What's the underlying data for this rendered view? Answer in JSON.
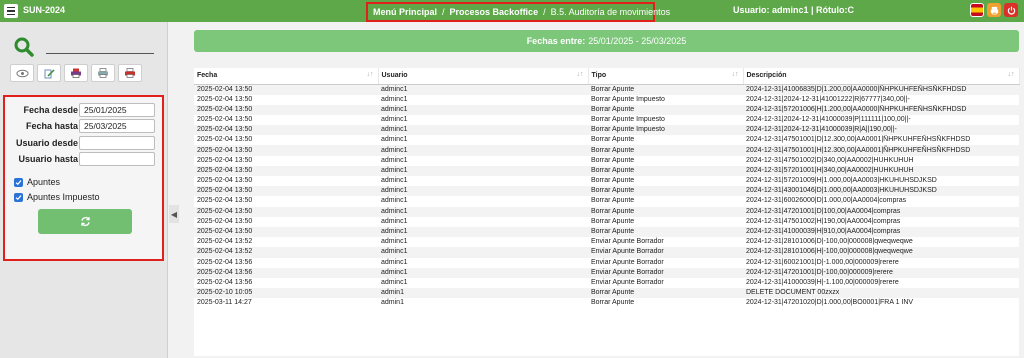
{
  "app": {
    "title": "SUN-2024",
    "user": "Usuario: adminc1 | Rótulo:C",
    "breadcrumb": [
      {
        "label": "Menú Principal"
      },
      {
        "label": "Procesos Backoffice"
      },
      {
        "label": "B.5. Auditoría de movimientos"
      }
    ],
    "separator": "/"
  },
  "icons": {
    "menu": "hamburger-menu-icon",
    "flag": "spain-flag-icon",
    "print": "print-icon",
    "power": "power-icon",
    "search": "search-icon",
    "tools": [
      "eye-icon",
      "edit-document-icon",
      "print-icon",
      "printer-alt-icon",
      "pdf-print-icon"
    ],
    "refresh": "refresh-icon",
    "collapse": "chevron-left-icon"
  },
  "colors": {
    "topbar": "#5fa84a",
    "banner": "#7cc77a",
    "highlight": "#e0201a",
    "refresh": "#72bf72"
  },
  "filters": {
    "fecha_desde_label": "Fecha desde",
    "fecha_desde_value": "25/01/2025",
    "fecha_hasta_label": "Fecha hasta",
    "fecha_hasta_value": "25/03/2025",
    "usuario_desde_label": "Usuario desde",
    "usuario_desde_value": "",
    "usuario_hasta_label": "Usuario hasta",
    "usuario_hasta_value": "",
    "apuntes_label": "Apuntes",
    "apuntes_checked": true,
    "apuntes_impuesto_label": "Apuntes Impuesto",
    "apuntes_impuesto_checked": true
  },
  "banner": {
    "label": "Fechas entre:",
    "value": "25/01/2025 - 25/03/2025"
  },
  "table": {
    "columns": [
      "Fecha",
      "Usuario",
      "Tipo",
      "Descripción"
    ],
    "rows": [
      [
        "2025-02-04 13:50",
        "adminc1",
        "Borrar Apunte",
        "2024-12-31|41006835|D|1.200,00|AA0000|ÑHPKUHFEÑHSÑKFHDSD"
      ],
      [
        "2025-02-04 13:50",
        "adminc1",
        "Borrar Apunte Impuesto",
        "2024-12-31|2024-12-31|41001222|R|67777|340,00||-"
      ],
      [
        "2025-02-04 13:50",
        "adminc1",
        "Borrar Apunte",
        "2024-12-31|57201006|H|1.200,00|AA0000|ÑHPKUHFEÑHSÑKFHDSD"
      ],
      [
        "2025-02-04 13:50",
        "adminc1",
        "Borrar Apunte Impuesto",
        "2024-12-31|2024-12-31|41000039|P|111111|100,00||-"
      ],
      [
        "2025-02-04 13:50",
        "adminc1",
        "Borrar Apunte Impuesto",
        "2024-12-31|2024-12-31|41000039|R|A||190,00||-"
      ],
      [
        "2025-02-04 13:50",
        "adminc1",
        "Borrar Apunte",
        "2024-12-31|47501001|D|12.300,00|AA0001|ÑHPKUHFEÑHSÑKFHDSD"
      ],
      [
        "2025-02-04 13:50",
        "adminc1",
        "Borrar Apunte",
        "2024-12-31|47501001|H|12.300,00|AA0001|ÑHPKUHFEÑHSÑKFHDSD"
      ],
      [
        "2025-02-04 13:50",
        "adminc1",
        "Borrar Apunte",
        "2024-12-31|47501002|D|340,00|AA0002|HUHKUHUH"
      ],
      [
        "2025-02-04 13:50",
        "adminc1",
        "Borrar Apunte",
        "2024-12-31|57201001|H|340,00|AA0002|HUHKUHUH"
      ],
      [
        "2025-02-04 13:50",
        "adminc1",
        "Borrar Apunte",
        "2024-12-31|57201009|H|1.000,00|AA0003|HKUHUHSDJKSD"
      ],
      [
        "2025-02-04 13:50",
        "adminc1",
        "Borrar Apunte",
        "2024-12-31|43001046|D|1.000,00|AA0003|HKUHUHSDJKSD"
      ],
      [
        "2025-02-04 13:50",
        "adminc1",
        "Borrar Apunte",
        "2024-12-31|60026000|D|1.000,00|AA0004|compras"
      ],
      [
        "2025-02-04 13:50",
        "adminc1",
        "Borrar Apunte",
        "2024-12-31|47201001|D|100,00|AA0004|compras"
      ],
      [
        "2025-02-04 13:50",
        "adminc1",
        "Borrar Apunte",
        "2024-12-31|47501002|H|190,00|AA0004|compras"
      ],
      [
        "2025-02-04 13:50",
        "adminc1",
        "Borrar Apunte",
        "2024-12-31|41000039|H|910,00|AA0004|compras"
      ],
      [
        "2025-02-04 13:52",
        "adminc1",
        "Enviar Apunte Borrador",
        "2024-12-31|28101006|D|-100,00|000008|qweqweqwe"
      ],
      [
        "2025-02-04 13:52",
        "adminc1",
        "Enviar Apunte Borrador",
        "2024-12-31|28101006|H|-100,00|000008|qweqweqwe"
      ],
      [
        "2025-02-04 13:56",
        "adminc1",
        "Enviar Apunte Borrador",
        "2024-12-31|60021001|D|-1.000,00|000009|rerere"
      ],
      [
        "2025-02-04 13:56",
        "adminc1",
        "Enviar Apunte Borrador",
        "2024-12-31|47201001|D|-100,00|000009|rerere"
      ],
      [
        "2025-02-04 13:56",
        "adminc1",
        "Enviar Apunte Borrador",
        "2024-12-31|41000039|H|-1.100,00|000009|rerere"
      ],
      [
        "2025-02-10 10:05",
        "admin1",
        "Borrar Apunte",
        "DELETE DOCUMENT 00zxzx"
      ],
      [
        "2025-03-11 14:27",
        "admin1",
        "Borrar Apunte",
        "2024-12-31|47201020|D|1.000,00|BO0001|FRA 1 INV"
      ]
    ]
  }
}
